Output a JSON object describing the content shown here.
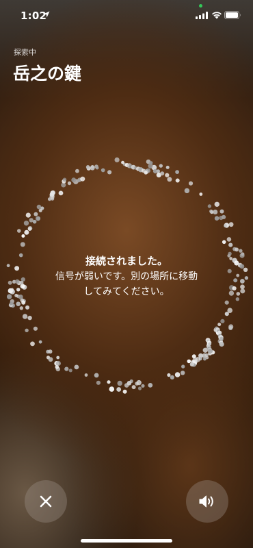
{
  "status_bar": {
    "time": "1:02",
    "icons": [
      "location-arrow-icon",
      "camera-in-use-dot",
      "cellular-signal-icon",
      "wifi-icon",
      "battery-icon"
    ],
    "camera_dot_color": "#34c759"
  },
  "header": {
    "status_label": "探索中",
    "item_name": "岳之の鍵"
  },
  "message": {
    "line1": "接続されました。",
    "line2": "信号が弱いです。別の場所に移動",
    "line3": "してみてください。"
  },
  "controls": {
    "close_icon": "close-icon",
    "sound_icon": "speaker-icon"
  },
  "colors": {
    "text": "#ffffff",
    "button_bg": "rgba(160,150,140,0.35)"
  }
}
